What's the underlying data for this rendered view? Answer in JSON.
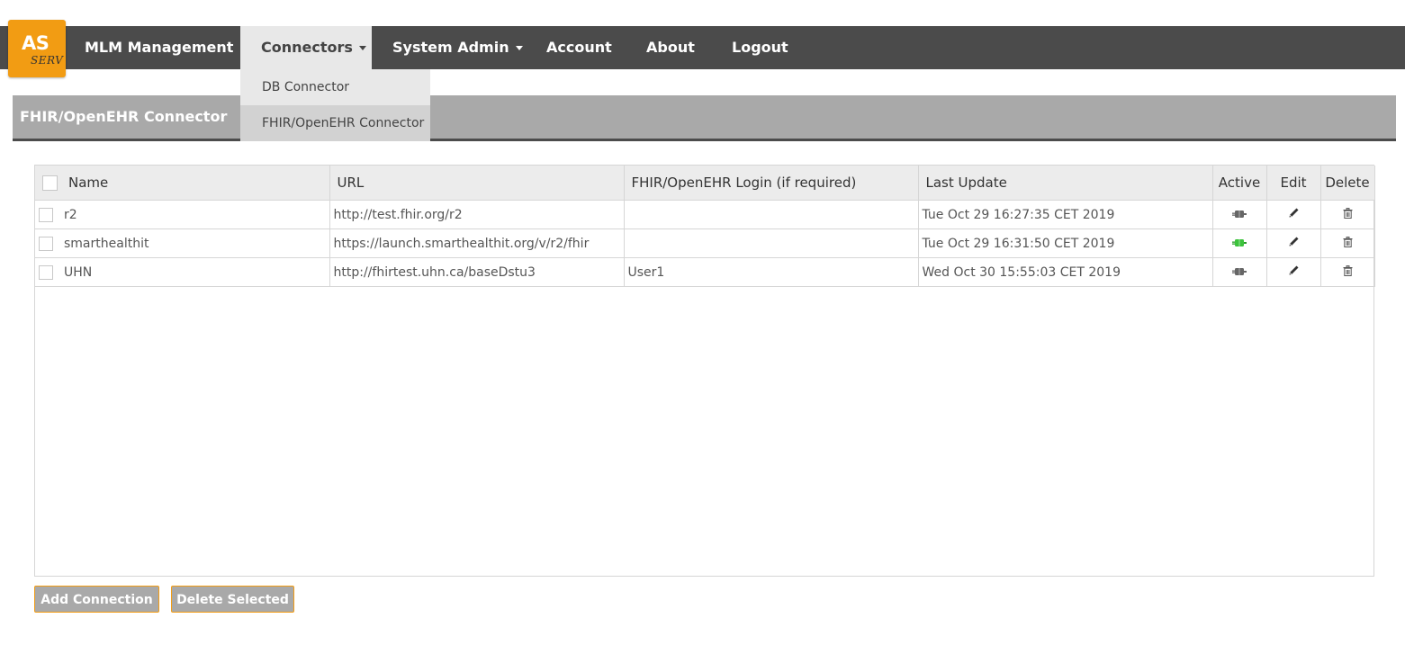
{
  "logo": {
    "main": "AS",
    "sub": "SERV"
  },
  "nav": {
    "items": [
      {
        "label": "MLM Management"
      },
      {
        "label": "Connectors"
      },
      {
        "label": "System Admin"
      },
      {
        "label": "Account"
      },
      {
        "label": "About"
      },
      {
        "label": "Logout"
      }
    ],
    "dropdown": [
      {
        "label": "DB Connector"
      },
      {
        "label": "FHIR/OpenEHR Connector"
      }
    ]
  },
  "page": {
    "title": "FHIR/OpenEHR Connector"
  },
  "table": {
    "columns": [
      "Name",
      "URL",
      "FHIR/OpenEHR Login (if required)",
      "Last Update",
      "Active",
      "Edit",
      "Delete"
    ],
    "rows": [
      {
        "name": "r2",
        "url": "http://test.fhir.org/r2",
        "login": "",
        "last_update": "Tue Oct 29 16:27:35 CET 2019",
        "active": false
      },
      {
        "name": "smarthealthit",
        "url": "https://launch.smarthealthit.org/v/r2/fhir",
        "login": "",
        "last_update": "Tue Oct 29 16:31:50 CET 2019",
        "active": true
      },
      {
        "name": "UHN",
        "url": "http://fhirtest.uhn.ca/baseDstu3",
        "login": "User1",
        "last_update": "Wed Oct 30 15:55:03 CET 2019",
        "active": false
      }
    ]
  },
  "buttons": {
    "add": "Add Connection",
    "delete_selected": "Delete Selected"
  },
  "colors": {
    "accent": "#f29c13",
    "nav_bg": "#4b4b4b",
    "header_bg": "#a9a9a9",
    "active_on": "#3cc33c",
    "active_off": "#666666"
  }
}
